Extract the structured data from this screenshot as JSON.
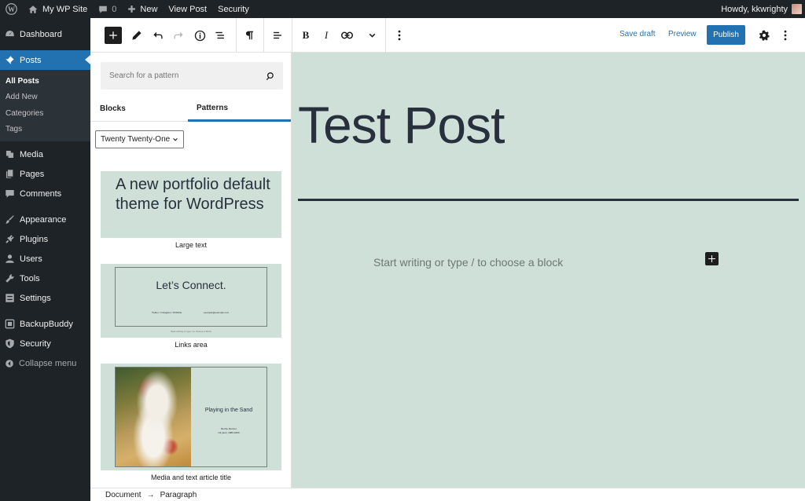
{
  "admin_bar": {
    "site_name": "My WP Site",
    "comments_count": "0",
    "new_label": "New",
    "view_post_label": "View Post",
    "security_label": "Security",
    "greeting": "Howdy, kkwrighty"
  },
  "sidebar": {
    "dashboard": "Dashboard",
    "posts": "Posts",
    "posts_submenu": [
      "All Posts",
      "Add New",
      "Categories",
      "Tags"
    ],
    "media": "Media",
    "pages": "Pages",
    "comments": "Comments",
    "appearance": "Appearance",
    "plugins": "Plugins",
    "users": "Users",
    "tools": "Tools",
    "settings": "Settings",
    "backupbuddy": "BackupBuddy",
    "security": "Security",
    "collapse": "Collapse menu"
  },
  "toolbar": {
    "save_draft": "Save draft",
    "preview": "Preview",
    "publish": "Publish"
  },
  "inserter": {
    "search_placeholder": "Search for a pattern",
    "tabs": [
      "Blocks",
      "Patterns"
    ],
    "active_tab": "Patterns",
    "category_select": "Twenty Twenty-One",
    "patterns": [
      {
        "label": "Large text",
        "preview_text": "A new portfolio default theme for WordPress"
      },
      {
        "label": "Links area",
        "preview_title": "Let’s Connect.",
        "preview_links": "Twitter / Instagram / Dribbble",
        "preview_email": "example@example.com",
        "preview_footer": "Start writing or type / to choose a block"
      },
      {
        "label": "Media and text article title",
        "preview_title": "Playing in the Sand",
        "preview_sub": "Berthe Morisot\nOil paint, 1889-1890"
      }
    ]
  },
  "canvas": {
    "post_title": "Test Post",
    "block_placeholder": "Start writing or type / to choose a block",
    "background_color": "#cfe0d8"
  },
  "footer": {
    "breadcrumb": [
      "Document",
      "Paragraph"
    ]
  },
  "colors": {
    "admin_dark": "#1d2327",
    "accent": "#2271b1"
  }
}
